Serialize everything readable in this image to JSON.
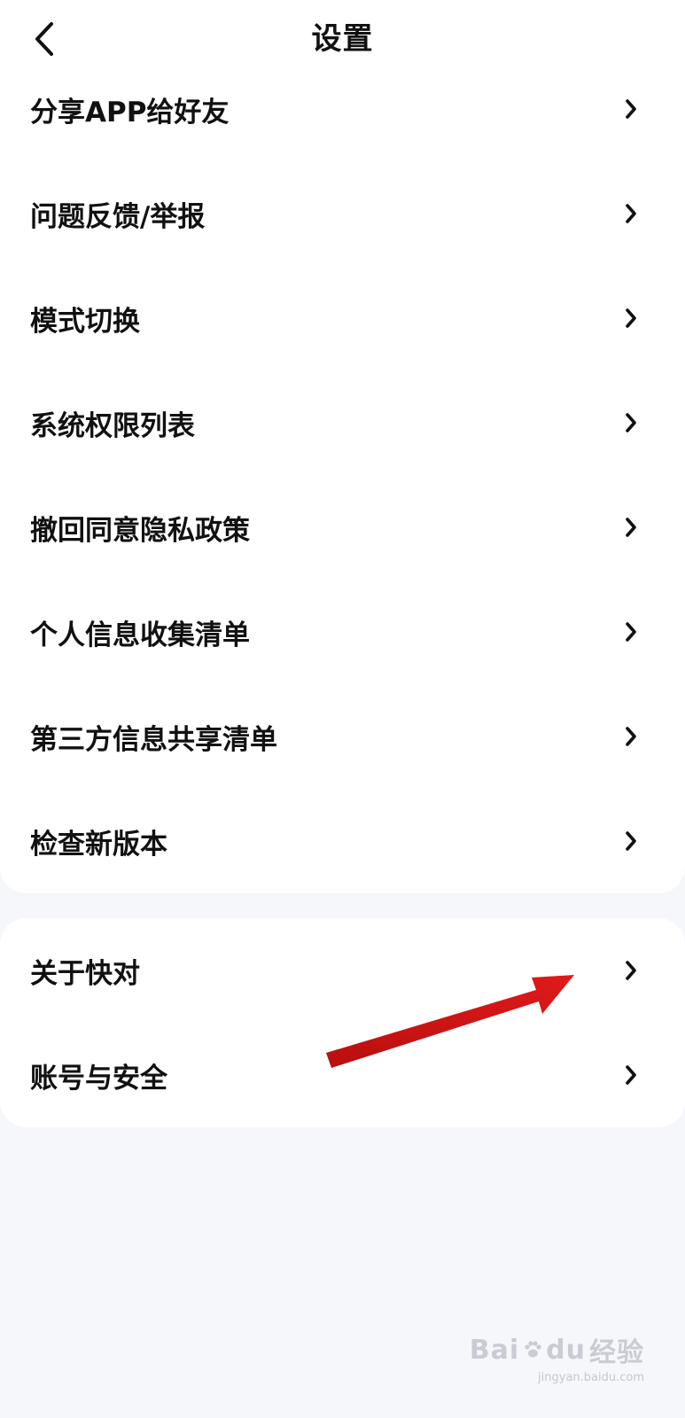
{
  "header": {
    "title": "设置",
    "back_icon": "chevron-left-icon"
  },
  "settings_group_1": {
    "items": [
      {
        "label": "分享APP给好友",
        "icon": "chevron-right-icon"
      },
      {
        "label": "问题反馈/举报",
        "icon": "chevron-right-icon"
      },
      {
        "label": "模式切换",
        "icon": "chevron-right-icon"
      },
      {
        "label": "系统权限列表",
        "icon": "chevron-right-icon"
      },
      {
        "label": "撤回同意隐私政策",
        "icon": "chevron-right-icon"
      },
      {
        "label": "个人信息收集清单",
        "icon": "chevron-right-icon"
      },
      {
        "label": "第三方信息共享清单",
        "icon": "chevron-right-icon"
      },
      {
        "label": "检查新版本",
        "icon": "chevron-right-icon"
      }
    ]
  },
  "settings_group_2": {
    "items": [
      {
        "label": "关于快对",
        "icon": "chevron-right-icon"
      },
      {
        "label": "账号与安全",
        "icon": "chevron-right-icon"
      }
    ]
  },
  "annotation": {
    "icon": "red-arrow-icon",
    "color": "#d01414"
  },
  "watermark": {
    "brand_latin": "Bai",
    "brand_latin_2": "du",
    "brand_cn": "经验",
    "url": "jingyan.baidu.com"
  },
  "colors": {
    "background": "#f6f7fb",
    "card": "#ffffff",
    "text": "#111111"
  }
}
